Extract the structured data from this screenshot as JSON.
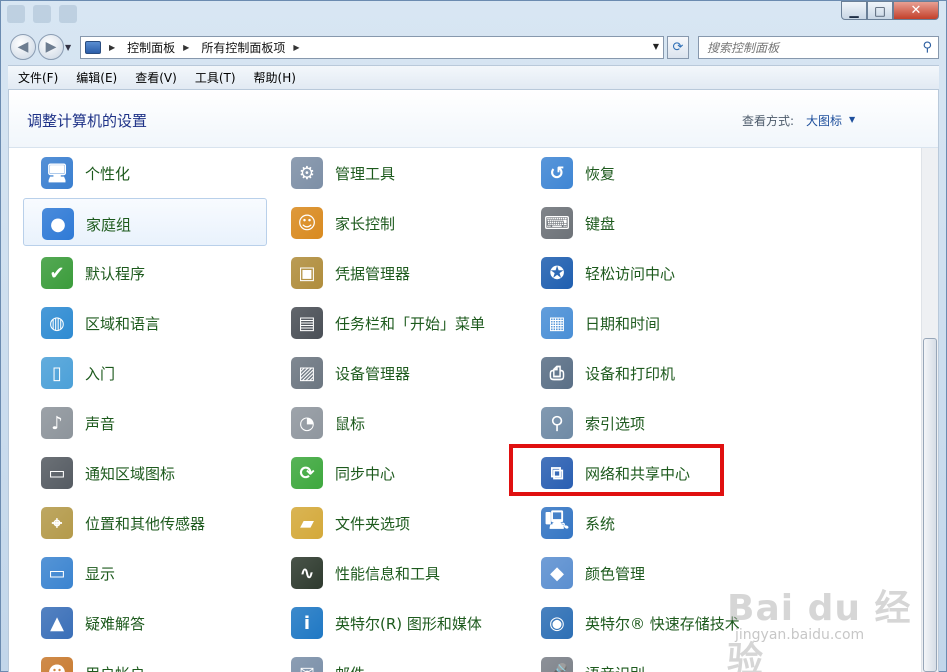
{
  "window": {
    "controls": {
      "minimize": "▁",
      "maximize": "□",
      "close": "✕"
    }
  },
  "navbar": {
    "back_glyph": "◀",
    "forward_glyph": "▶",
    "breadcrumbs": [
      "控制面板",
      "所有控制面板项"
    ],
    "refresh_glyph": "⟳",
    "search_placeholder": "搜索控制面板",
    "search_glyph": "⚲"
  },
  "menubar": [
    "文件(F)",
    "编辑(E)",
    "查看(V)",
    "工具(T)",
    "帮助(H)"
  ],
  "header": {
    "title": "调整计算机的设置",
    "view_label": "查看方式:",
    "view_value": "大图标"
  },
  "items": [
    {
      "label": "个性化",
      "icon": "personalization-icon",
      "color": "#3a7fd0",
      "glyph": "🖥"
    },
    {
      "label": "管理工具",
      "icon": "admin-tools-icon",
      "color": "#7d8fa6",
      "glyph": "⚙"
    },
    {
      "label": "恢复",
      "icon": "recovery-icon",
      "color": "#3f86d4",
      "glyph": "↺"
    },
    {
      "label": "家庭组",
      "icon": "homegroup-icon",
      "color": "#2f7ad6",
      "glyph": "●"
    },
    {
      "label": "家长控制",
      "icon": "parental-controls-icon",
      "color": "#d98a1f",
      "glyph": "☺"
    },
    {
      "label": "键盘",
      "icon": "keyboard-icon",
      "color": "#6d7278",
      "glyph": "⌨"
    },
    {
      "label": "默认程序",
      "icon": "default-programs-icon",
      "color": "#3b9c3b",
      "glyph": "✔"
    },
    {
      "label": "凭据管理器",
      "icon": "credential-manager-icon",
      "color": "#b08d3c",
      "glyph": "▣"
    },
    {
      "label": "轻松访问中心",
      "icon": "ease-of-access-icon",
      "color": "#1f5fb0",
      "glyph": "✪"
    },
    {
      "label": "区域和语言",
      "icon": "region-language-icon",
      "color": "#2e8bd2",
      "glyph": "◍"
    },
    {
      "label": "任务栏和「开始」菜单",
      "icon": "taskbar-start-menu-icon",
      "color": "#4a4f56",
      "glyph": "▤"
    },
    {
      "label": "日期和时间",
      "icon": "date-time-icon",
      "color": "#4a8fd6",
      "glyph": "▦"
    },
    {
      "label": "入门",
      "icon": "getting-started-icon",
      "color": "#4ba0d8",
      "glyph": "▯"
    },
    {
      "label": "设备管理器",
      "icon": "device-manager-icon",
      "color": "#6c7681",
      "glyph": "▨"
    },
    {
      "label": "设备和打印机",
      "icon": "devices-printers-icon",
      "color": "#5a6f86",
      "glyph": "⎙"
    },
    {
      "label": "声音",
      "icon": "sound-icon",
      "color": "#8d949b",
      "glyph": "♪"
    },
    {
      "label": "鼠标",
      "icon": "mouse-icon",
      "color": "#8f969e",
      "glyph": "◔"
    },
    {
      "label": "索引选项",
      "icon": "indexing-options-icon",
      "color": "#6f8aa5",
      "glyph": "⚲"
    },
    {
      "label": "通知区域图标",
      "icon": "notification-area-icon",
      "color": "#555b62",
      "glyph": "▭"
    },
    {
      "label": "同步中心",
      "icon": "sync-center-icon",
      "color": "#3ea83e",
      "glyph": "⟳"
    },
    {
      "label": "网络和共享中心",
      "icon": "network-sharing-center-icon",
      "color": "#2a5fb2",
      "glyph": "⧉"
    },
    {
      "label": "位置和其他传感器",
      "icon": "location-sensors-icon",
      "color": "#b49a4a",
      "glyph": "⌖"
    },
    {
      "label": "文件夹选项",
      "icon": "folder-options-icon",
      "color": "#d4a93a",
      "glyph": "▰"
    },
    {
      "label": "系统",
      "icon": "system-icon",
      "color": "#3576c4",
      "glyph": "🖳"
    },
    {
      "label": "显示",
      "icon": "display-icon",
      "color": "#3b84d0",
      "glyph": "▭"
    },
    {
      "label": "性能信息和工具",
      "icon": "performance-icon",
      "color": "#2e3a2e",
      "glyph": "∿"
    },
    {
      "label": "颜色管理",
      "icon": "color-management-icon",
      "color": "#5b8fd0",
      "glyph": "◆"
    },
    {
      "label": "疑难解答",
      "icon": "troubleshooting-icon",
      "color": "#3a6fb8",
      "glyph": "▲"
    },
    {
      "label": "英特尔(R) 图形和媒体",
      "icon": "intel-graphics-icon",
      "color": "#1f78c4",
      "glyph": "i"
    },
    {
      "label": "英特尔® 快速存储技术",
      "icon": "intel-rapid-storage-icon",
      "color": "#2d6fb5",
      "glyph": "◉"
    },
    {
      "label": "用户帐户",
      "icon": "user-accounts-icon",
      "color": "#c87a2f",
      "glyph": "☻"
    },
    {
      "label": "邮件",
      "icon": "mail-icon",
      "color": "#7a8fa8",
      "glyph": "✉"
    },
    {
      "label": "语音识别",
      "icon": "speech-recognition-icon",
      "color": "#7b8088",
      "glyph": "🎤"
    }
  ],
  "watermark": {
    "logo": "Bai du 经验",
    "url": "jingyan.baidu.com"
  }
}
